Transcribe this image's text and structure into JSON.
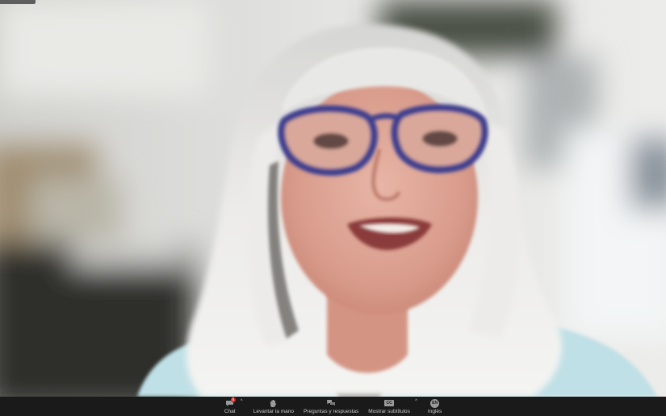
{
  "meeting": {
    "participant_video": "speaker-video",
    "name_tag": ""
  },
  "toolbar": {
    "items": [
      {
        "id": "chat",
        "label": "Chat",
        "icon": "chat-icon",
        "badge": "6",
        "has_caret": true
      },
      {
        "id": "raise-hand",
        "label": "Levantar la mano",
        "icon": "hand-icon",
        "has_caret": false
      },
      {
        "id": "qa",
        "label": "Preguntas y respuestas",
        "icon": "qa-icon",
        "has_caret": false
      },
      {
        "id": "subtitles",
        "label": "Mostrar subtítulos",
        "icon": "cc-icon",
        "icon_text": "CC",
        "has_caret": true
      },
      {
        "id": "language",
        "label": "Inglés",
        "icon": "globe-language-icon",
        "icon_text": "EN",
        "has_caret": false
      }
    ]
  },
  "colors": {
    "toolbar_bg": "#1a1a1a",
    "toolbar_text": "#c8c8c8",
    "badge": "#e02828",
    "hair": "#e6e6e4",
    "glasses": "#3f3f8f",
    "shirt": "#bfe0e6"
  }
}
